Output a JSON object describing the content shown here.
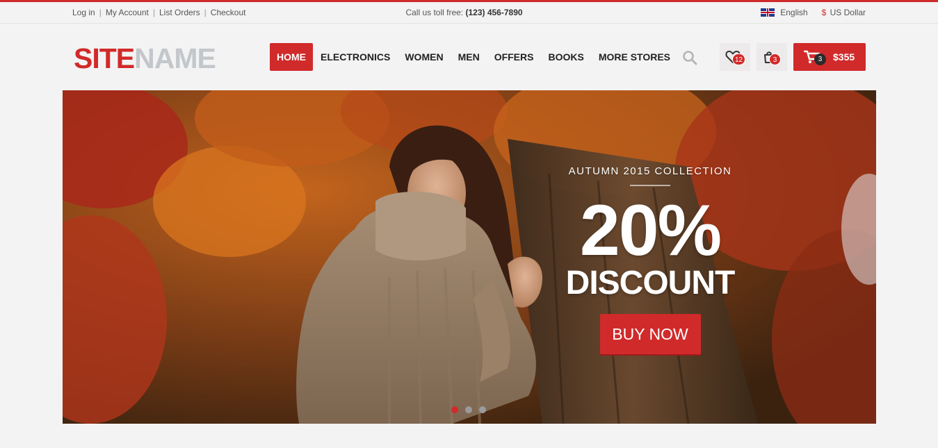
{
  "topbar": {
    "links": [
      {
        "label": "Log in"
      },
      {
        "label": "My Account"
      },
      {
        "label": "List Orders"
      },
      {
        "label": "Checkout"
      }
    ],
    "separator": "|",
    "call_prefix": "Call us toll free:",
    "phone": "(123) 456-7890",
    "language": "English",
    "language_icon": "uk-flag-icon",
    "currency_symbol": "$",
    "currency": "US Dollar"
  },
  "logo": {
    "part1": "SITE",
    "part2": "NAME"
  },
  "nav": {
    "items": [
      {
        "label": "HOME",
        "active": true
      },
      {
        "label": "ELECTRONICS"
      },
      {
        "label": "WOMEN"
      },
      {
        "label": "MEN"
      },
      {
        "label": "OFFERS"
      },
      {
        "label": "BOOKS"
      },
      {
        "label": "MORE STORES"
      }
    ]
  },
  "actions": {
    "wishlist_count": "12",
    "compare_count": "3",
    "cart_count": "3",
    "cart_total": "$355"
  },
  "hero": {
    "eyebrow": "AUTUMN 2015 COLLECTION",
    "headline": "20%",
    "subheadline": "DISCOUNT",
    "cta": "BUY NOW",
    "slide_count": 3,
    "active_slide": 1
  },
  "colors": {
    "accent": "#d12a2a",
    "logo_secondary": "#c3c7cb",
    "background": "#f3f3f3"
  }
}
